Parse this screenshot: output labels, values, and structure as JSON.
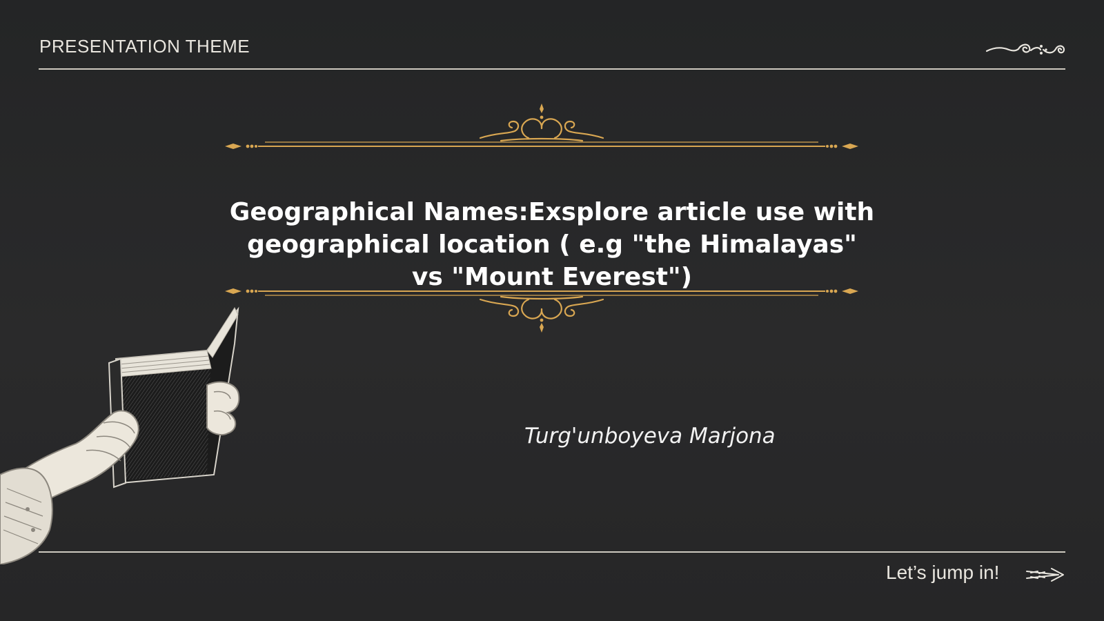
{
  "header": {
    "title": "PRESENTATION THEME"
  },
  "slide": {
    "title": "Geographical Names:Exsplore article use with geographical location ( e.g \"the Himalayas\" vs \"Mount Everest\")",
    "author": "Turg'unboyeva Marjona"
  },
  "footer": {
    "cta_label": "Let’s jump in!"
  },
  "icons": {
    "top_right": "flourish-icon",
    "frame": "ornamental-divider-icon",
    "cta": "arrow-right-icon",
    "illustration": "hand-holding-book-icon"
  },
  "colors": {
    "background": "#262627",
    "gold": "#d9a752",
    "text": "#ffffff",
    "rule": "#cfcac0"
  }
}
